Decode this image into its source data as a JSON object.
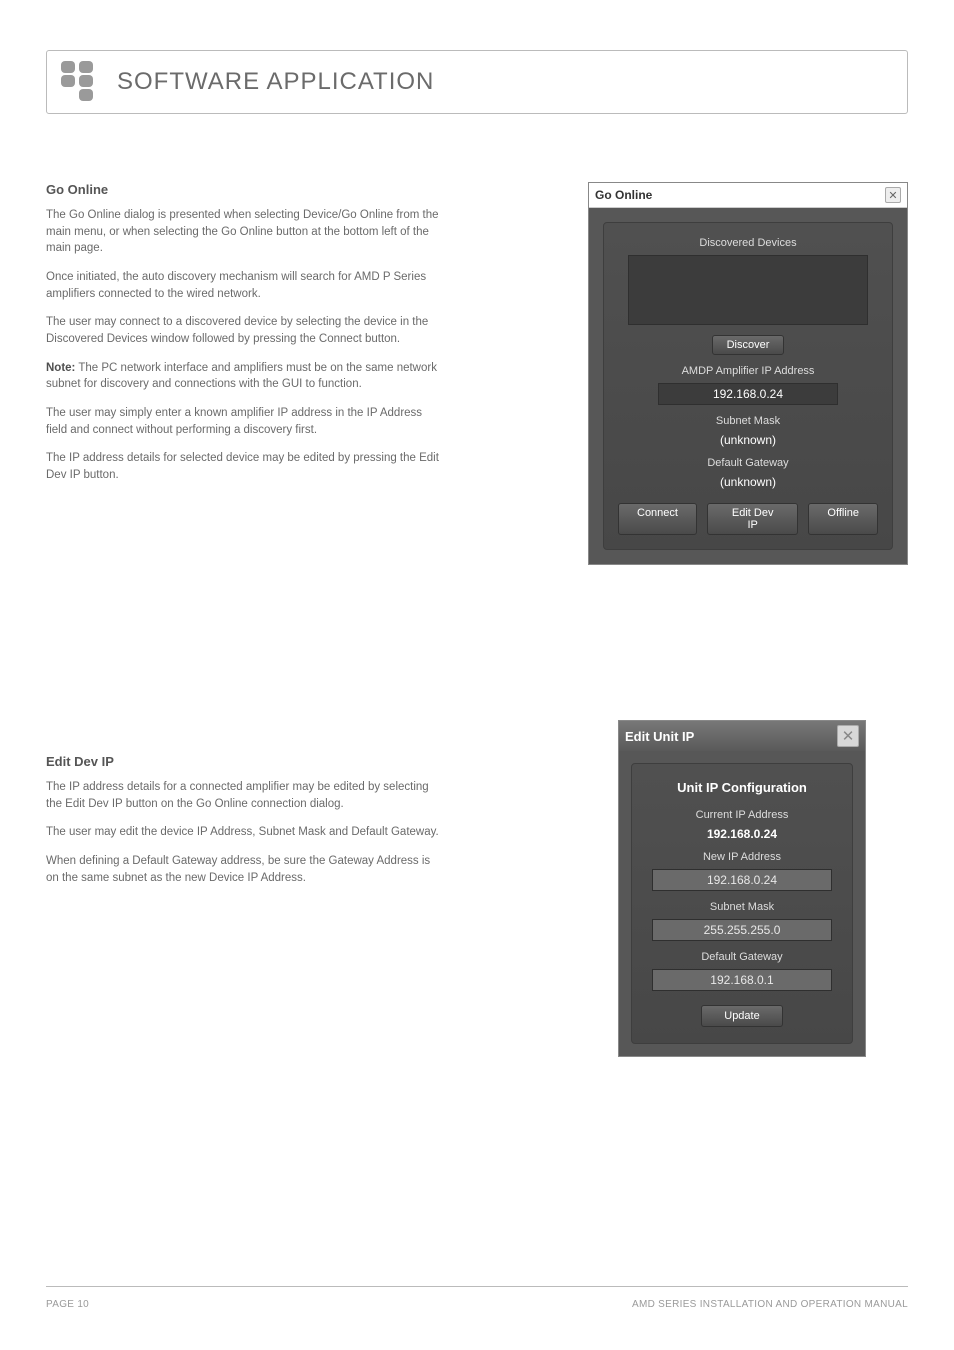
{
  "header": {
    "title": "SOFTWARE APPLICATION"
  },
  "section1": {
    "heading": "Go Online",
    "p1": "The Go Online dialog is presented when selecting Device/Go Online from the main menu, or when selecting the Go Online button at the bottom left of the main page.",
    "p2": "Once initiated, the auto discovery mechanism will search for AMD P Series amplifiers connected to the wired network.",
    "p3": "The user may connect to a discovered device by selecting the device in the Discovered Devices window followed by pressing the Connect button.",
    "p4a": "Note:",
    "p4b": "  The PC network interface and amplifiers must be on the same network subnet for discovery and connections with the GUI to function.",
    "p5": "The user may simply enter a known amplifier IP address in the IP Address field and connect without performing a discovery first.",
    "p6": "The IP address details for selected device may be edited by pressing the Edit Dev IP button."
  },
  "dialog1": {
    "title": "Go Online",
    "discovered_label": "Discovered Devices",
    "discover_btn": "Discover",
    "ip_label": "AMDP Amplifier IP Address",
    "ip_value": "192.168.0.24",
    "subnet_label": "Subnet Mask",
    "subnet_value": "(unknown)",
    "gateway_label": "Default Gateway",
    "gateway_value": "(unknown)",
    "connect_btn": "Connect",
    "editdev_btn": "Edit Dev IP",
    "offline_btn": "Offline"
  },
  "section2": {
    "heading": "Edit Dev IP",
    "p1": "The IP address details for a connected amplifier may be edited by selecting the Edit Dev IP button on the Go Online connection dialog.",
    "p2": "The user may edit the device IP Address, Subnet Mask and Default Gateway.",
    "p3": "When defining a Default Gateway address, be sure the Gateway Address is on the same subnet as the new Device IP Address."
  },
  "dialog2": {
    "title": "Edit Unit IP",
    "cfg_title": "Unit IP Configuration",
    "cur_label": "Current IP Address",
    "cur_value": "192.168.0.24",
    "new_label": "New IP Address",
    "new_value": "192.168.0.24",
    "subnet_label": "Subnet Mask",
    "subnet_value": "255.255.255.0",
    "gateway_label": "Default Gateway",
    "gateway_value": "192.168.0.1",
    "update_btn": "Update"
  },
  "footer": {
    "left": "PAGE 10",
    "right": "AMD SERIES INSTALLATION AND OPERATION MANUAL"
  }
}
